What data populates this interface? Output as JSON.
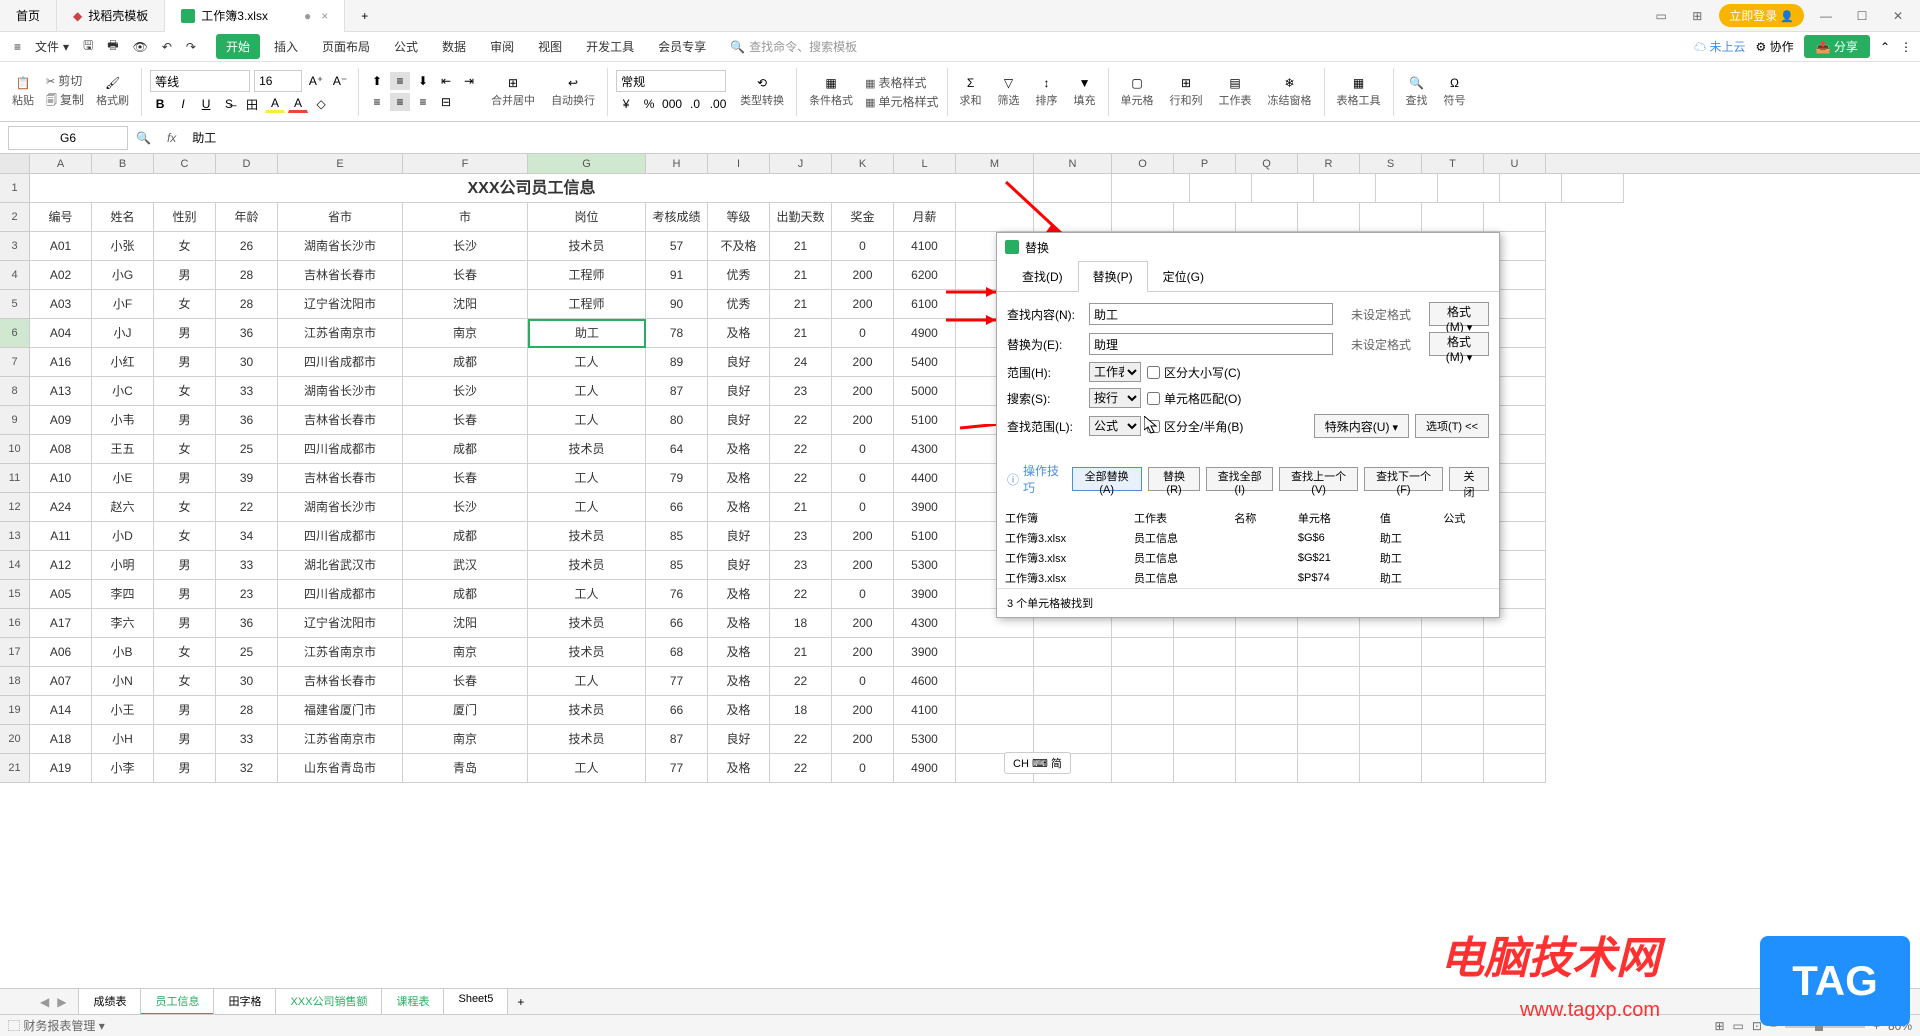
{
  "titlebar": {
    "tabs": [
      {
        "label": "首页",
        "icon": "home"
      },
      {
        "label": "找稻壳模板",
        "icon": "template"
      },
      {
        "label": "工作簿3.xlsx",
        "icon": "sheet",
        "active": true
      }
    ],
    "login": "立即登录",
    "add_tab": "+"
  },
  "menubar": {
    "file": "文件",
    "tabs": [
      "开始",
      "插入",
      "页面布局",
      "公式",
      "数据",
      "审阅",
      "视图",
      "开发工具",
      "会员专享"
    ],
    "active_tab": "开始",
    "search_placeholder": "查找命令、搜索模板",
    "cloud": "未上云",
    "coop": "协作",
    "share": "分享"
  },
  "ribbon": {
    "paste": "粘贴",
    "cut": "剪切",
    "copy": "复制",
    "format_painter": "格式刷",
    "font_name": "等线",
    "font_size": "16",
    "merge": "合并居中",
    "wrap": "自动换行",
    "number_format": "常规",
    "type_convert": "类型转换",
    "cond_format": "条件格式",
    "table_style": "表格样式",
    "cell_style": "单元格样式",
    "sum": "求和",
    "filter": "筛选",
    "sort": "排序",
    "fill": "填充",
    "cells": "单元格",
    "rows_cols": "行和列",
    "worksheet": "工作表",
    "freeze": "冻结窗格",
    "table_tool": "表格工具",
    "find": "查找",
    "symbol": "符号"
  },
  "formula_bar": {
    "name_box": "G6",
    "formula": "助工"
  },
  "columns": [
    "A",
    "B",
    "C",
    "D",
    "E",
    "F",
    "G",
    "H",
    "I",
    "J",
    "K",
    "L",
    "M",
    "N",
    "O",
    "P",
    "Q",
    "R",
    "S",
    "T",
    "U"
  ],
  "title_row": "XXX公司员工信息",
  "headers": [
    "编号",
    "姓名",
    "性别",
    "年龄",
    "省市",
    "市",
    "岗位",
    "考核成绩",
    "等级",
    "出勤天数",
    "奖金",
    "月薪"
  ],
  "rows": [
    [
      "A01",
      "小张",
      "女",
      "26",
      "湖南省长沙市",
      "长沙",
      "技术员",
      "57",
      "不及格",
      "21",
      "0",
      "4100"
    ],
    [
      "A02",
      "小G",
      "男",
      "28",
      "吉林省长春市",
      "长春",
      "工程师",
      "91",
      "优秀",
      "21",
      "200",
      "6200"
    ],
    [
      "A03",
      "小F",
      "女",
      "28",
      "辽宁省沈阳市",
      "沈阳",
      "工程师",
      "90",
      "优秀",
      "21",
      "200",
      "6100"
    ],
    [
      "A04",
      "小J",
      "男",
      "36",
      "江苏省南京市",
      "南京",
      "助工",
      "78",
      "及格",
      "21",
      "0",
      "4900"
    ],
    [
      "A16",
      "小红",
      "男",
      "30",
      "四川省成都市",
      "成都",
      "工人",
      "89",
      "良好",
      "24",
      "200",
      "5400"
    ],
    [
      "A13",
      "小C",
      "女",
      "33",
      "湖南省长沙市",
      "长沙",
      "工人",
      "87",
      "良好",
      "23",
      "200",
      "5000"
    ],
    [
      "A09",
      "小韦",
      "男",
      "36",
      "吉林省长春市",
      "长春",
      "工人",
      "80",
      "良好",
      "22",
      "200",
      "5100"
    ],
    [
      "A08",
      "王五",
      "女",
      "25",
      "四川省成都市",
      "成都",
      "技术员",
      "64",
      "及格",
      "22",
      "0",
      "4300"
    ],
    [
      "A10",
      "小E",
      "男",
      "39",
      "吉林省长春市",
      "长春",
      "工人",
      "79",
      "及格",
      "22",
      "0",
      "4400"
    ],
    [
      "A24",
      "赵六",
      "女",
      "22",
      "湖南省长沙市",
      "长沙",
      "工人",
      "66",
      "及格",
      "21",
      "0",
      "3900"
    ],
    [
      "A11",
      "小D",
      "女",
      "34",
      "四川省成都市",
      "成都",
      "技术员",
      "85",
      "良好",
      "23",
      "200",
      "5100"
    ],
    [
      "A12",
      "小明",
      "男",
      "33",
      "湖北省武汉市",
      "武汉",
      "技术员",
      "85",
      "良好",
      "23",
      "200",
      "5300"
    ],
    [
      "A05",
      "李四",
      "男",
      "23",
      "四川省成都市",
      "成都",
      "工人",
      "76",
      "及格",
      "22",
      "0",
      "3900"
    ],
    [
      "A17",
      "李六",
      "男",
      "36",
      "辽宁省沈阳市",
      "沈阳",
      "技术员",
      "66",
      "及格",
      "18",
      "200",
      "4300"
    ],
    [
      "A06",
      "小B",
      "女",
      "25",
      "江苏省南京市",
      "南京",
      "技术员",
      "68",
      "及格",
      "21",
      "200",
      "3900"
    ],
    [
      "A07",
      "小N",
      "女",
      "30",
      "吉林省长春市",
      "长春",
      "工人",
      "77",
      "及格",
      "22",
      "0",
      "4600"
    ],
    [
      "A14",
      "小王",
      "男",
      "28",
      "福建省厦门市",
      "厦门",
      "技术员",
      "66",
      "及格",
      "18",
      "200",
      "4100"
    ],
    [
      "A18",
      "小H",
      "男",
      "33",
      "江苏省南京市",
      "南京",
      "技术员",
      "87",
      "良好",
      "22",
      "200",
      "5300"
    ],
    [
      "A19",
      "小李",
      "男",
      "32",
      "山东省青岛市",
      "青岛",
      "工人",
      "77",
      "及格",
      "22",
      "0",
      "4900"
    ]
  ],
  "selected_cell": {
    "row": 5,
    "col": 6
  },
  "dialog": {
    "title": "替换",
    "tabs": [
      "查找(D)",
      "替换(P)",
      "定位(G)"
    ],
    "active_tab": 1,
    "find_label": "查找内容(N):",
    "find_value": "助工",
    "replace_label": "替换为(E):",
    "replace_value": "助理",
    "no_format": "未设定格式",
    "format_btn": "格式(M)",
    "range_label": "范围(H):",
    "range_value": "工作表",
    "search_label": "搜索(S):",
    "search_value": "按行",
    "lookin_label": "查找范围(L):",
    "lookin_value": "公式",
    "cb_case": "区分大小写(C)",
    "cb_whole": "单元格匹配(O)",
    "cb_width": "区分全/半角(B)",
    "special": "特殊内容(U)",
    "options": "选项(T) <<",
    "tips": "操作技巧",
    "btn_replace_all": "全部替换(A)",
    "btn_replace": "替换(R)",
    "btn_find_all": "查找全部(I)",
    "btn_prev": "查找上一个(V)",
    "btn_next": "查找下一个(F)",
    "btn_close": "关闭",
    "result_headers": [
      "工作簿",
      "工作表",
      "名称",
      "单元格",
      "值",
      "公式"
    ],
    "results": [
      [
        "工作簿3.xlsx",
        "员工信息",
        "",
        "$G$6",
        "助工",
        ""
      ],
      [
        "工作簿3.xlsx",
        "员工信息",
        "",
        "$G$21",
        "助工",
        ""
      ],
      [
        "工作簿3.xlsx",
        "员工信息",
        "",
        "$P$74",
        "助工",
        ""
      ]
    ],
    "status": "3 个单元格被找到"
  },
  "sheet_tabs": [
    "成绩表",
    "员工信息",
    "田字格",
    "XXX公司销售额",
    "课程表",
    "Sheet5"
  ],
  "active_sheet": 1,
  "statusbar": {
    "left": "财务报表管理",
    "ime": "CH ⌨ 简",
    "zoom": "80%"
  },
  "watermark": {
    "line1": "电脑技术网",
    "line2": "www.tagxp.com",
    "tag": "TAG"
  }
}
